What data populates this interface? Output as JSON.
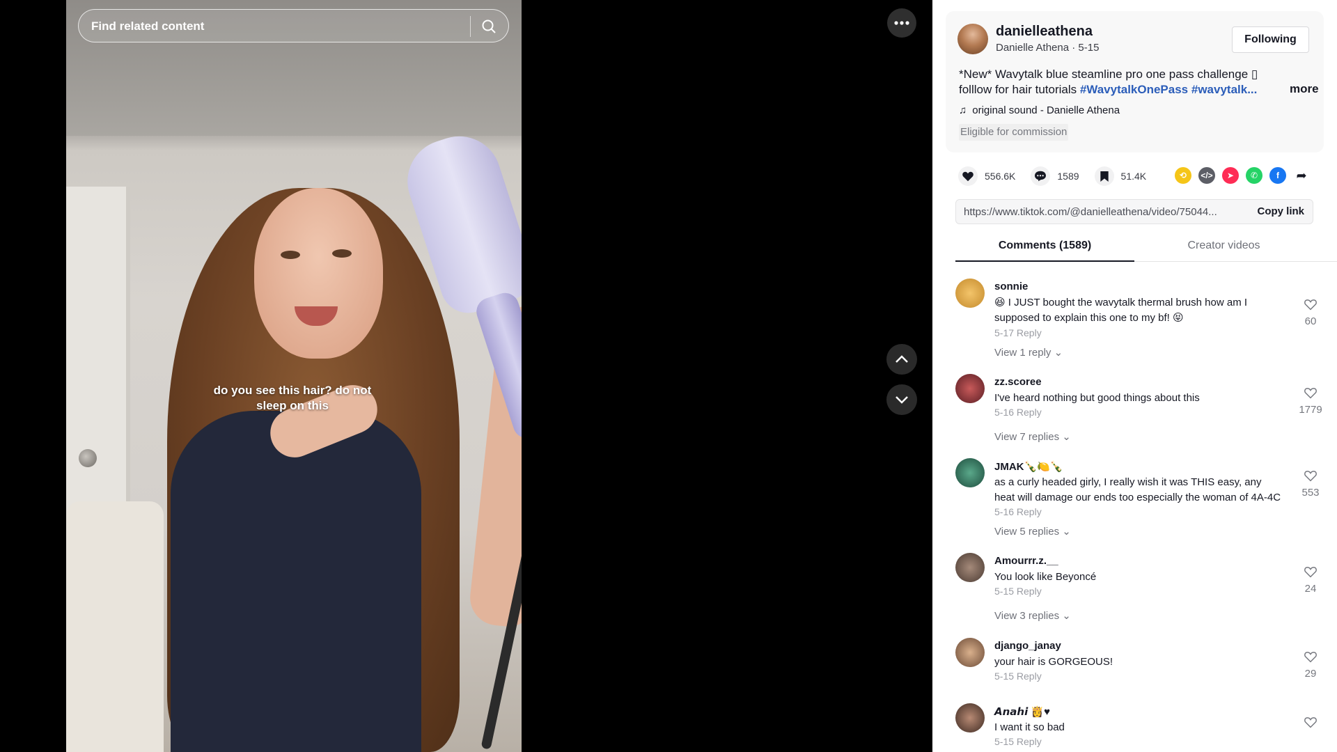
{
  "search": {
    "placeholder": "Find related content"
  },
  "video": {
    "caption_line1": "do you see this hair? do not",
    "caption_line2": "sleep on this"
  },
  "post": {
    "handle": "danielleathena",
    "display_name_date": "Danielle Athena · 5-15",
    "follow_label": "Following",
    "desc_line1": "*New* Wavytalk blue steamline pro one pass challenge",
    "desc_line2_prefix": "folllow for hair tutorials ",
    "hashtag1": "#WavytalkOnePass",
    "hashtag2": " #wavytalk...",
    "more_label": "more",
    "sound": "original sound - Danielle Athena",
    "commission": "Eligible for commission"
  },
  "stats": {
    "likes": "556.6K",
    "comments": "1589",
    "saves": "51.4K"
  },
  "share_icons": [
    "repost-icon",
    "embed-icon",
    "send-to-friends-icon",
    "whatsapp-icon",
    "facebook-icon",
    "share-arrow-icon"
  ],
  "link": {
    "url": "https://www.tiktok.com/@danielleathena/video/75044...",
    "copy_label": "Copy link"
  },
  "tabs": {
    "comments": "Comments (1589)",
    "creator": "Creator videos"
  },
  "comments": [
    {
      "user": "sonnie",
      "text": "😆 I JUST bought the wavytalk thermal brush how am I supposed to explain this one to my bf! 😝",
      "meta": "5-17 Reply",
      "replies": "View 1 reply",
      "likes": "60"
    },
    {
      "user": "zz.scoree",
      "text": "I've heard nothing but good things about this",
      "meta": "5-16 Reply",
      "replies": "View 7 replies",
      "likes": "1779"
    },
    {
      "user": "JMAK🍾🍋🍾",
      "text": "as a curly headed girly, I really wish it was THIS easy, any heat will damage our ends too especially the woman of 4A-4C",
      "meta": "5-16 Reply",
      "replies": "View 5 replies",
      "likes": "553"
    },
    {
      "user": "Amourrr.z.__",
      "text": "You look like Beyoncé",
      "meta": "5-15 Reply",
      "replies": "View 3 replies",
      "likes": "24"
    },
    {
      "user": "django_janay",
      "text": "your hair is GORGEOUS!",
      "meta": "5-15 Reply",
      "replies": "",
      "likes": "29"
    },
    {
      "user": "𝘼𝙣𝙖𝙝𝙞 👸♥",
      "text": "I want it so bad",
      "meta": "5-15 Reply",
      "replies": "",
      "likes": ""
    }
  ],
  "colors": {
    "hashtag": "#2b5db9",
    "text": "#161823",
    "muted": "#75777e"
  }
}
